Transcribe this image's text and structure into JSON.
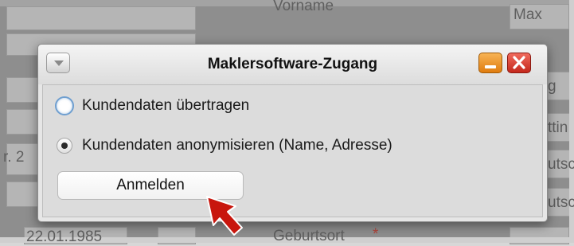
{
  "background": {
    "field_label_top": "Vorname",
    "field_value_top": "Max",
    "field_label_bottom": "Geburtsort",
    "required_mark": "*",
    "date_partial": "22.01.1985",
    "left_partial": "r. 2",
    "right_partials": [
      "g",
      "ttin",
      "utsc",
      "utsc"
    ]
  },
  "dialog": {
    "title": "Maklersoftware-Zugang",
    "options": [
      {
        "label": "Kundendaten übertragen",
        "selected": false
      },
      {
        "label": "Kundendaten anonymisieren (Name, Adresse)",
        "selected": true
      }
    ],
    "login_label": "Anmelden"
  },
  "colors": {
    "minimize": "#ee9a2e",
    "close": "#de4437",
    "cursor": "#c8160d",
    "radio_focus": "#6f9fd0"
  },
  "icons": [
    "menu-down-icon",
    "minimize-icon",
    "close-icon",
    "arrow-cursor-icon"
  ]
}
